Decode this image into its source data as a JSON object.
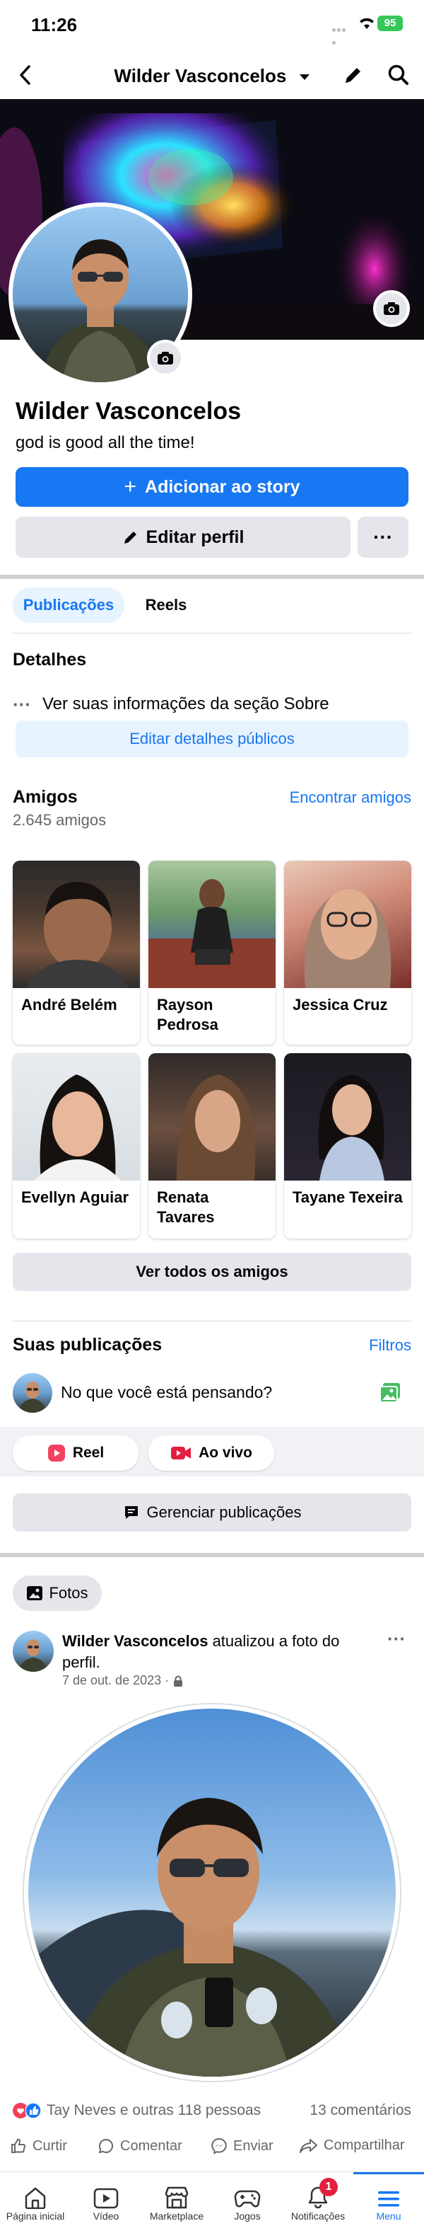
{
  "status_bar": {
    "time": "11:26",
    "battery": "95"
  },
  "header": {
    "title": "Wilder Vasconcelos"
  },
  "profile": {
    "name": "Wilder Vasconcelos",
    "bio": "god is good all the time!",
    "add_story_label": "Adicionar ao story",
    "edit_profile_label": "Editar perfil"
  },
  "tabs": [
    {
      "label": "Publicações"
    },
    {
      "label": "Reels"
    }
  ],
  "details": {
    "title": "Detalhes",
    "about_link": "Ver suas informações da seção Sobre",
    "edit_public_label": "Editar detalhes públicos"
  },
  "friends": {
    "title": "Amigos",
    "count": "2.645 amigos",
    "find_label": "Encontrar amigos",
    "list": [
      {
        "name": "André Belém"
      },
      {
        "name": "Rayson Pedrosa"
      },
      {
        "name": "Jessica Cruz"
      },
      {
        "name": "Evellyn Aguiar"
      },
      {
        "name": "Renata Tavares"
      },
      {
        "name": "Tayane Texeira"
      }
    ],
    "see_all_label": "Ver todos os amigos"
  },
  "posts": {
    "title": "Suas publicações",
    "filters_label": "Filtros",
    "composer_placeholder": "No que você está pensando?",
    "reel_label": "Reel",
    "live_label": "Ao vivo",
    "manage_label": "Gerenciar publicações"
  },
  "photos_chip": {
    "label": "Fotos"
  },
  "post": {
    "author": "Wilder Vasconcelos",
    "action": " atualizou a foto do perfil.",
    "date": "7 de out. de 2023 ·",
    "reactions": "Tay Neves e outras 118 pessoas",
    "comments": "13 comentários",
    "like_label": "Curtir",
    "comment_label": "Comentar",
    "send_label": "Enviar",
    "share_label": "Compartilhar"
  },
  "bottom_nav": [
    {
      "label": "Página inicial",
      "icon": "home-icon"
    },
    {
      "label": "Vídeo",
      "icon": "video-icon"
    },
    {
      "label": "Marketplace",
      "icon": "marketplace-icon"
    },
    {
      "label": "Jogos",
      "icon": "games-icon"
    },
    {
      "label": "Notificações",
      "icon": "bell-icon",
      "badge": "1"
    },
    {
      "label": "Menu",
      "icon": "menu-icon"
    }
  ],
  "colors": {
    "brand": "#1877f2",
    "badge": "#e41e3f"
  }
}
